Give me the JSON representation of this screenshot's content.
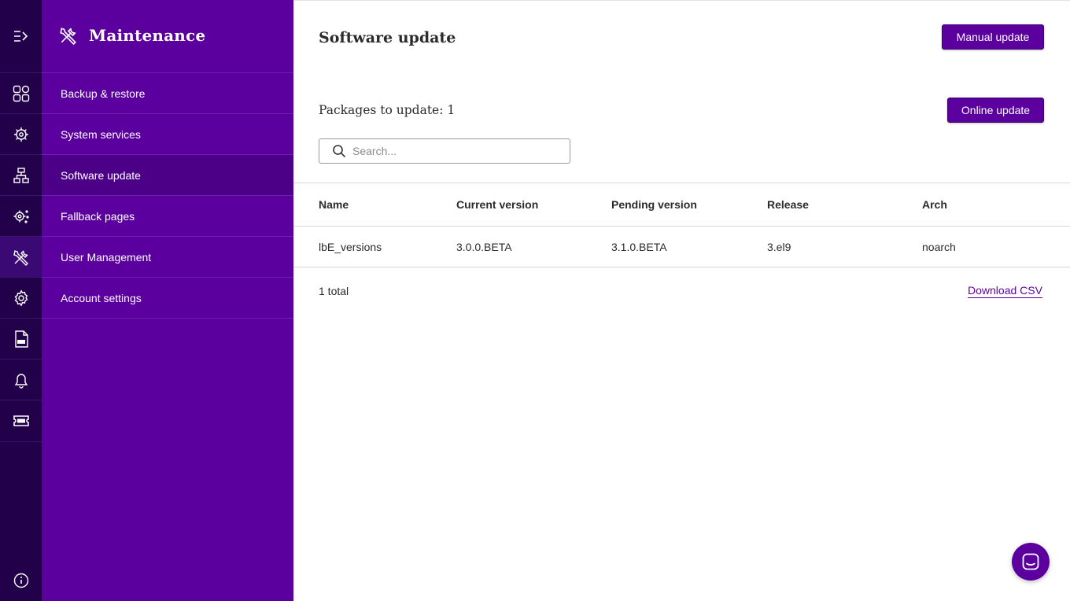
{
  "colors": {
    "rail_bg": "#23004a",
    "panel_bg": "#5b009f",
    "panel_active": "#4c0088",
    "accent": "#5b009f"
  },
  "rail": {
    "icons": [
      "expand-menu-icon",
      "dashboard-grid-icon",
      "location-settings-icon",
      "network-topology-icon",
      "gear-share-icon",
      "tools-icon",
      "gear-icon",
      "log-file-icon",
      "bell-icon",
      "ticket-icon",
      "info-icon"
    ]
  },
  "sidebar": {
    "title": "Maintenance",
    "items": [
      {
        "label": "Backup & restore"
      },
      {
        "label": "System services"
      },
      {
        "label": "Software update"
      },
      {
        "label": "Fallback pages"
      },
      {
        "label": "User Management"
      },
      {
        "label": "Account settings"
      }
    ],
    "active_index": 2
  },
  "main": {
    "title": "Software update",
    "manual_update_label": "Manual update",
    "online_update_label": "Online update",
    "packages_label": "Packages to update: 1",
    "search": {
      "placeholder": "Search...",
      "value": ""
    },
    "table": {
      "columns": [
        "Name",
        "Current version",
        "Pending version",
        "Release",
        "Arch"
      ],
      "rows": [
        [
          "lbE_versions",
          "3.0.0.BETA",
          "3.1.0.BETA",
          "3.el9",
          "noarch"
        ]
      ]
    },
    "total_label": "1 total",
    "download_csv_label": "Download CSV"
  }
}
